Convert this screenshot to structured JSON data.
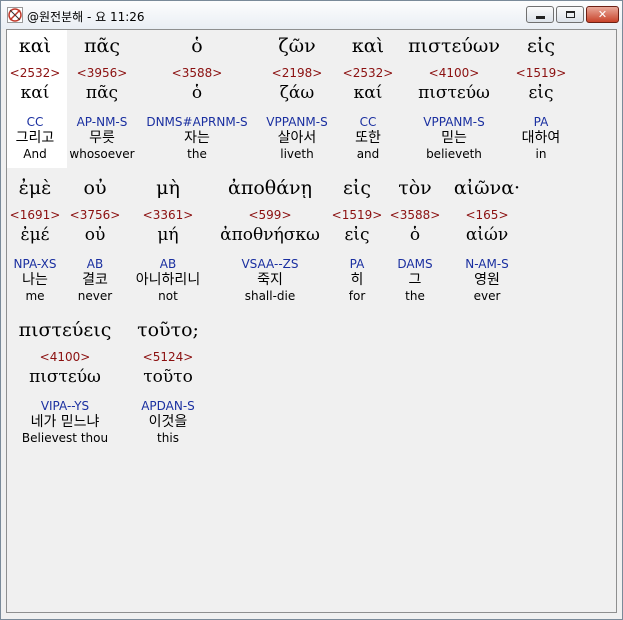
{
  "window": {
    "title": "@원전분해 - 요 11:26",
    "icon": "app-compass-icon",
    "controls": [
      "minimize",
      "maximize",
      "close"
    ]
  },
  "colors": {
    "strongs": "#8b1010",
    "parsing": "#1a2fa0",
    "text": "#000000",
    "background": "#f0f0f0",
    "selected_background": "#ffffff"
  },
  "lines": [
    {
      "words": [
        {
          "greek": "καὶ",
          "strongs": "<2532>",
          "lemma": "καί",
          "parsing": "CC",
          "korean": "그리고",
          "english": "And"
        },
        {
          "greek": "πᾶς",
          "strongs": "<3956>",
          "lemma": "πᾶς",
          "parsing": "AP-NM-S",
          "korean": "무릇",
          "english": "whosoever"
        },
        {
          "greek": "ὁ",
          "strongs": "<3588>",
          "lemma": "ὁ",
          "parsing": "DNMS#APRNM-S",
          "korean": "자는",
          "english": "the"
        },
        {
          "greek": "ζῶν",
          "strongs": "<2198>",
          "lemma": "ζάω",
          "parsing": "VPPANM-S",
          "korean": "살아서",
          "english": "liveth"
        },
        {
          "greek": "καὶ",
          "strongs": "<2532>",
          "lemma": "καί",
          "parsing": "CC",
          "korean": "또한",
          "english": "and"
        },
        {
          "greek": "πιστεύων",
          "strongs": "<4100>",
          "lemma": "πιστεύω",
          "parsing": "VPPANM-S",
          "korean": "믿는",
          "english": "believeth"
        },
        {
          "greek": "εἰς",
          "strongs": "<1519>",
          "lemma": "εἰς",
          "parsing": "PA",
          "korean": "대하여",
          "english": "in"
        }
      ]
    },
    {
      "words": [
        {
          "greek": "ἐμὲ",
          "strongs": "<1691>",
          "lemma": "ἐμέ",
          "parsing": "NPA-XS",
          "korean": "나는",
          "english": "me"
        },
        {
          "greek": "οὐ",
          "strongs": "<3756>",
          "lemma": "οὐ",
          "parsing": "AB",
          "korean": "결코",
          "english": "never"
        },
        {
          "greek": "μὴ",
          "strongs": "<3361>",
          "lemma": "μή",
          "parsing": "AB",
          "korean": "아니하리니",
          "english": "not"
        },
        {
          "greek": "ἀποθάνῃ",
          "strongs": "<599>",
          "lemma": "ἀποθνήσκω",
          "parsing": "VSAA--ZS",
          "korean": "죽지",
          "english": "shall-die"
        },
        {
          "greek": "εἰς",
          "strongs": "<1519>",
          "lemma": "εἰς",
          "parsing": "PA",
          "korean": "히",
          "english": "for"
        },
        {
          "greek": "τὸν",
          "strongs": "<3588>",
          "lemma": "ὁ",
          "parsing": "DAMS",
          "korean": "그",
          "english": "the"
        },
        {
          "greek": "αἰῶνα·",
          "strongs": "<165>",
          "lemma": "αἰών",
          "parsing": "N-AM-S",
          "korean": "영원",
          "english": "ever"
        }
      ]
    },
    {
      "words": [
        {
          "greek": "πιστεύεις",
          "strongs": "<4100>",
          "lemma": "πιστεύω",
          "parsing": "VIPA--YS",
          "korean": "네가 믿느냐",
          "english": "Believest thou"
        },
        {
          "greek": "τοῦτο;",
          "strongs": "<5124>",
          "lemma": "τοῦτο",
          "parsing": "APDAN-S",
          "korean": "이것을",
          "english": "this"
        }
      ]
    }
  ]
}
